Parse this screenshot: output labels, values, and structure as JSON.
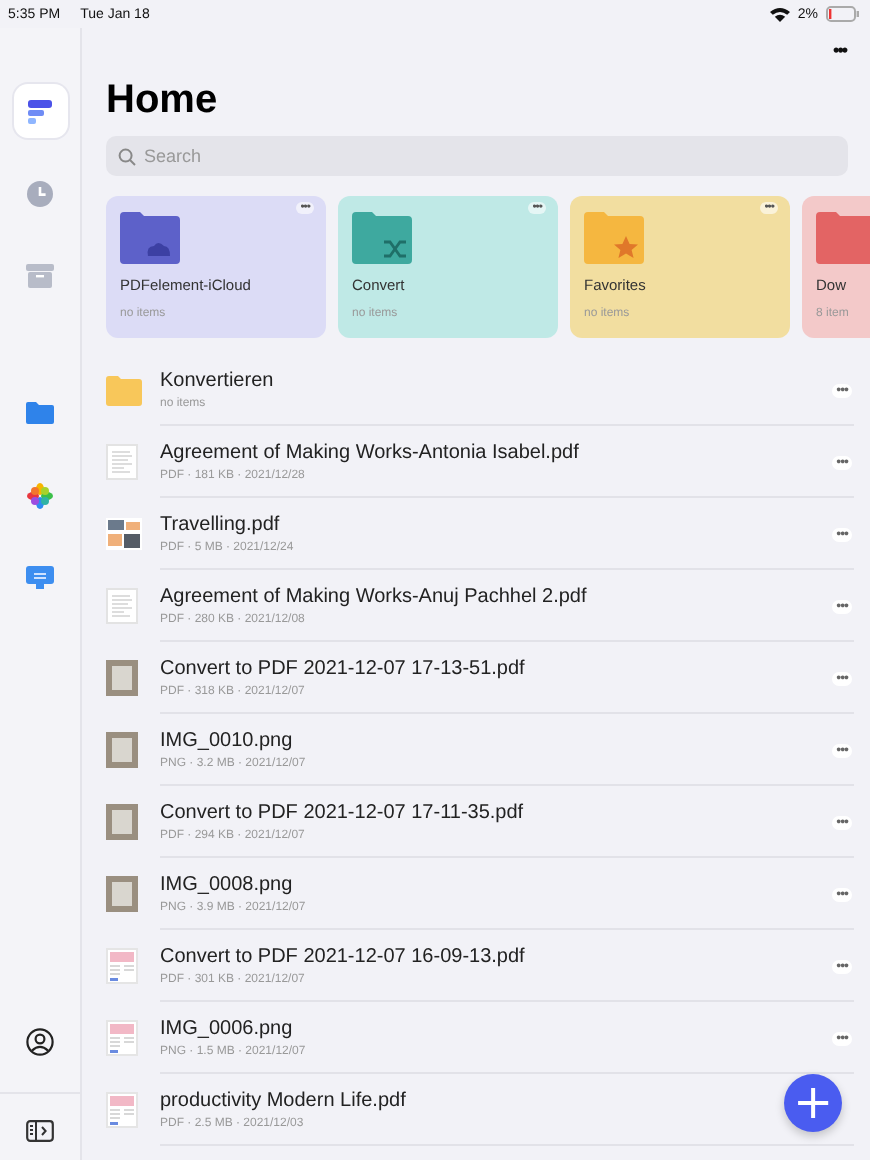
{
  "status_bar": {
    "time": "5:35 PM",
    "date": "Tue Jan 18",
    "battery": "2%"
  },
  "sidebar": {
    "items": [
      {
        "kind": "logo",
        "selected": true
      },
      {
        "kind": "clock",
        "selected": false
      },
      {
        "kind": "box",
        "selected": false
      },
      {
        "kind": "folder",
        "selected": false
      },
      {
        "kind": "photos",
        "selected": false
      },
      {
        "kind": "monitor",
        "selected": false
      }
    ],
    "bottom": [
      {
        "kind": "profile"
      },
      {
        "kind": "panel"
      }
    ]
  },
  "more_menu": "•••",
  "title": "Home",
  "search": {
    "placeholder": "Search"
  },
  "cards": [
    {
      "name": "PDFelement-iCloud",
      "count": "no items",
      "color": "#dcdcf6",
      "kind": "cloud",
      "more": "•••"
    },
    {
      "name": "Convert",
      "count": "no items",
      "color": "#bfe9e6",
      "kind": "shuffle",
      "more": "•••"
    },
    {
      "name": "Favorites",
      "count": "no items",
      "color": "#f2dea0",
      "kind": "star",
      "more": "•••"
    },
    {
      "name": "Dow",
      "count": "8 item",
      "color": "#f3c9c9",
      "kind": "download"
    }
  ],
  "files": [
    {
      "kind": "folder",
      "name": "Konvertieren",
      "meta": "no items",
      "more": "•••"
    },
    {
      "kind": "doc",
      "name": "Agreement of Making Works-Antonia Isabel.pdf",
      "meta": "PDF · 181 KB · 2021/12/28",
      "more": "•••"
    },
    {
      "kind": "collage",
      "name": "Travelling.pdf",
      "meta": "PDF · 5 MB · 2021/12/24",
      "more": "•••"
    },
    {
      "kind": "doc",
      "name": "Agreement of Making Works-Anuj Pachhel 2.pdf",
      "meta": "PDF · 280 KB · 2021/12/08",
      "more": "•••"
    },
    {
      "kind": "photo",
      "name": "Convert to PDF 2021-12-07 17-13-51.pdf",
      "meta": "PDF · 318 KB · 2021/12/07",
      "more": "•••"
    },
    {
      "kind": "photo",
      "name": "IMG_0010.png",
      "meta": "PNG · 3.2 MB · 2021/12/07",
      "more": "•••"
    },
    {
      "kind": "photo",
      "name": "Convert to PDF 2021-12-07 17-11-35.pdf",
      "meta": "PDF · 294 KB · 2021/12/07",
      "more": "•••"
    },
    {
      "kind": "photo",
      "name": "IMG_0008.png",
      "meta": "PNG · 3.9 MB · 2021/12/07",
      "more": "•••"
    },
    {
      "kind": "magazine",
      "name": "Convert to PDF 2021-12-07 16-09-13.pdf",
      "meta": "PDF · 301 KB · 2021/12/07",
      "more": "•••"
    },
    {
      "kind": "magazine",
      "name": "IMG_0006.png",
      "meta": "PNG · 1.5 MB · 2021/12/07",
      "more": "•••"
    },
    {
      "kind": "magazine",
      "name": "productivity Modern Life.pdf",
      "meta": "PDF · 2.5 MB · 2021/12/03"
    }
  ],
  "fab": "+"
}
